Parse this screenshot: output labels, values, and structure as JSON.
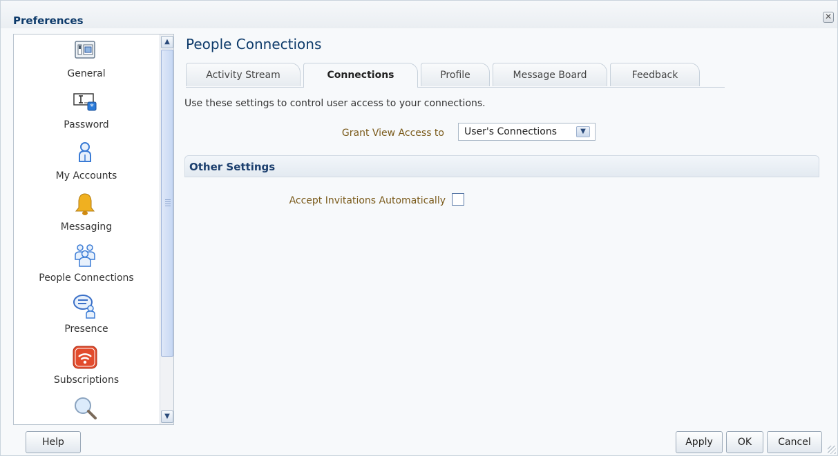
{
  "dialog": {
    "title": "Preferences",
    "close_icon": "close-icon"
  },
  "sidebar": {
    "items": [
      {
        "label": "General",
        "icon": "general-settings-icon"
      },
      {
        "label": "Password",
        "icon": "password-icon"
      },
      {
        "label": "My Accounts",
        "icon": "user-icon"
      },
      {
        "label": "Messaging",
        "icon": "bell-icon"
      },
      {
        "label": "People Connections",
        "icon": "people-group-icon"
      },
      {
        "label": "Presence",
        "icon": "presence-chat-icon"
      },
      {
        "label": "Subscriptions",
        "icon": "subscription-feed-icon"
      },
      {
        "label": "",
        "icon": "search-magnifier-icon"
      }
    ]
  },
  "main": {
    "title": "People Connections",
    "tabs": [
      {
        "label": "Activity Stream",
        "active": false
      },
      {
        "label": "Connections",
        "active": true
      },
      {
        "label": "Profile",
        "active": false
      },
      {
        "label": "Message Board",
        "active": false
      },
      {
        "label": "Feedback",
        "active": false
      }
    ],
    "intro": "Use these settings to control user access to your connections.",
    "grant_view_label": "Grant View Access to",
    "grant_view_value": "User's Connections",
    "other_settings_title": "Other Settings",
    "accept_invitations_label": "Accept Invitations Automatically",
    "accept_invitations_checked": false
  },
  "footer": {
    "help_label": "Help",
    "apply_label": "Apply",
    "ok_label": "OK",
    "cancel_label": "Cancel"
  },
  "colors": {
    "title_blue": "#0d3a6a",
    "label_gold": "#7a5a1a",
    "bell_gold": "#f0b020",
    "subscription_red": "#e24b2c",
    "people_blue": "#3a7bd5"
  }
}
